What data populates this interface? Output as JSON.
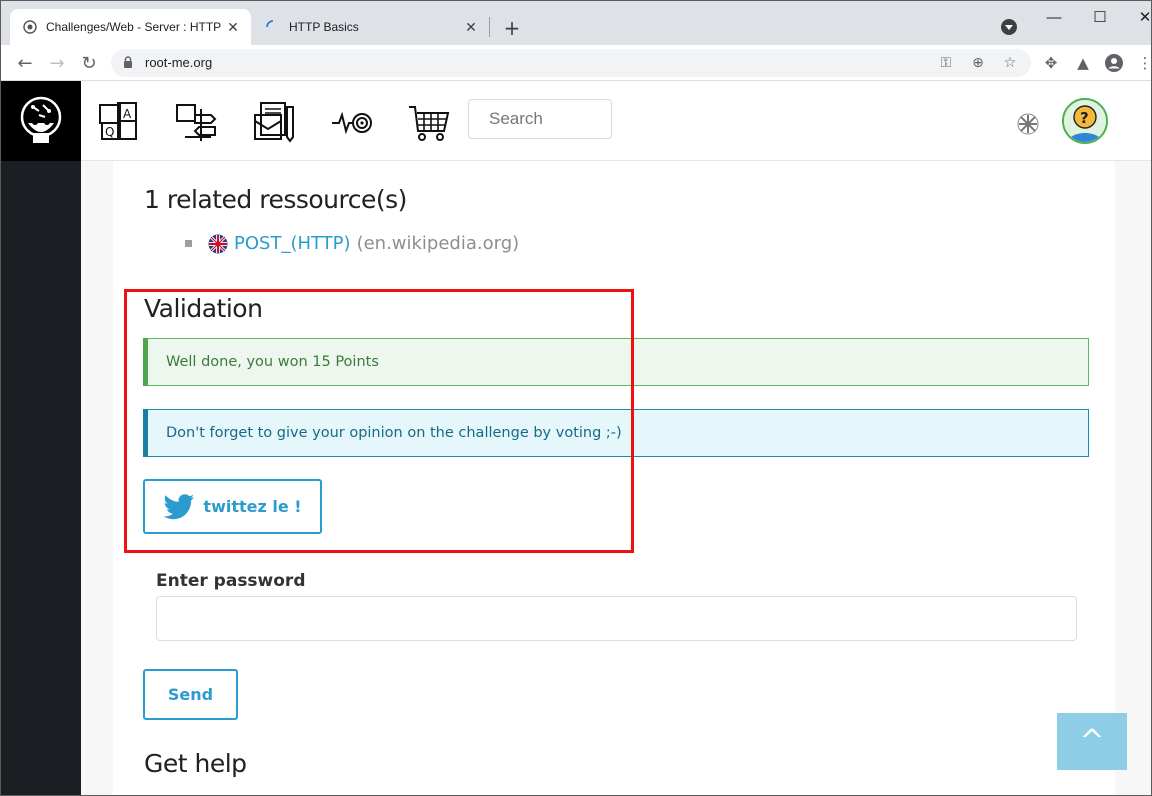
{
  "browser": {
    "tabs": [
      {
        "title": "Challenges/Web - Server : HTTP",
        "active": true
      },
      {
        "title": "HTTP Basics",
        "active": false
      }
    ],
    "url": "root-me.org"
  },
  "site": {
    "search_placeholder": "Search",
    "nav_icons": [
      "faq-icon",
      "roadmap-icon",
      "documents-icon",
      "activity-target-icon",
      "shopping-cart-icon"
    ]
  },
  "resources": {
    "heading": "1 related ressource(s)",
    "items": [
      {
        "link": "POST_(HTTP)",
        "domain": "(en.wikipedia.org)"
      }
    ]
  },
  "validation": {
    "heading": "Validation",
    "success_message": "Well done, you won 15 Points",
    "info_message": "Don't forget to give your opinion on the challenge by voting ;-)",
    "tweet_label": "twittez le !"
  },
  "password_form": {
    "label": "Enter password",
    "value": "",
    "send_label": "Send"
  },
  "help": {
    "heading": "Get help"
  },
  "scroll_top_label": "^",
  "colors": {
    "link": "#2c9ccf",
    "success_bg": "#edf7ee",
    "info_bg": "#e6f7fc",
    "highlight": "#ee1111"
  }
}
